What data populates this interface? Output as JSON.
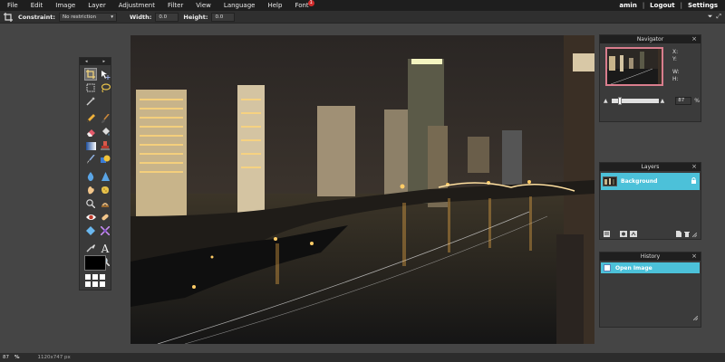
{
  "menubar": {
    "items": [
      "File",
      "Edit",
      "Image",
      "Layer",
      "Adjustment",
      "Filter",
      "View",
      "Language",
      "Help",
      "Font"
    ],
    "font_badge": "1",
    "user": "amin",
    "logout": "Logout",
    "settings": "Settings"
  },
  "options": {
    "constraint_label": "Constraint:",
    "constraint_value": "No restriction",
    "width_label": "Width:",
    "width_value": "0.0",
    "height_label": "Height:",
    "height_value": "0.0"
  },
  "navigator": {
    "title": "Navigator",
    "x_label": "X:",
    "y_label": "Y:",
    "w_label": "W:",
    "h_label": "H:",
    "zoom_value": "87",
    "zoom_unit": "%",
    "zoom_fraction": 0.15
  },
  "layers": {
    "title": "Layers",
    "items": [
      {
        "name": "Background"
      }
    ]
  },
  "history": {
    "title": "History",
    "items": [
      {
        "name": "Open Image"
      }
    ]
  },
  "statusbar": {
    "zoom": "87",
    "unit": "%",
    "dimensions": "1120x747 px"
  },
  "colors": {
    "accent": "#4cc1d9",
    "menubar_bg": "#1e1e1e",
    "workspace_bg": "#454545",
    "primary_color": "#000000"
  },
  "icons": {
    "toolbox": [
      "crop-icon",
      "move-icon",
      "marquee-icon",
      "lasso-icon",
      "magic-wand-icon",
      "pencil-icon",
      "brush-icon",
      "eraser-icon",
      "paint-bucket-icon",
      "gradient-icon",
      "clone-stamp-icon",
      "color-replace-icon",
      "drawing-icon",
      "blur-icon",
      "sharpen-icon",
      "smudge-icon",
      "sponge-icon",
      "dodge-icon",
      "burn-icon",
      "red-eye-icon",
      "spot-heal-icon",
      "bloat-icon",
      "pinch-icon",
      "color-picker-icon",
      "type-icon",
      "hand-icon",
      "zoom-icon"
    ]
  }
}
